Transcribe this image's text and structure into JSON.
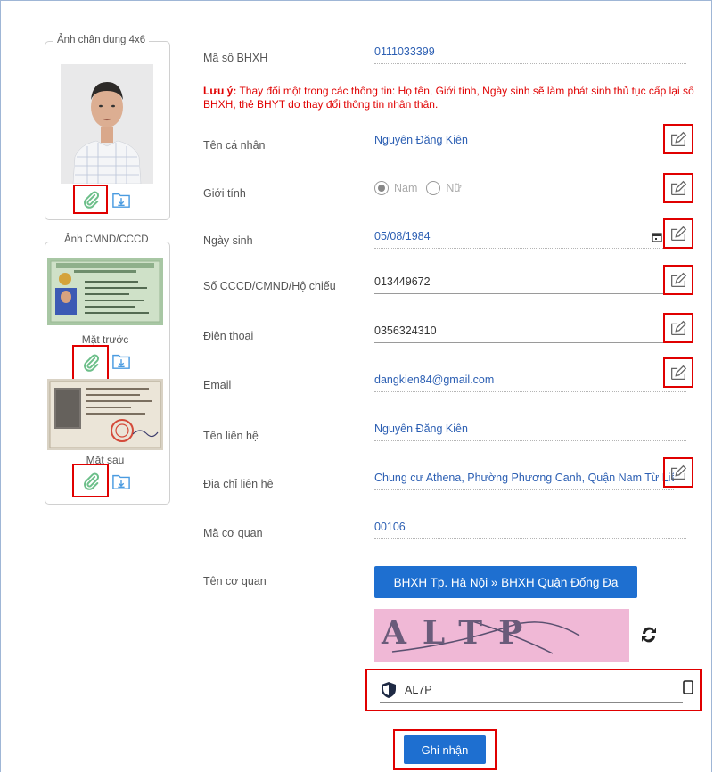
{
  "portrait": {
    "title": "Ảnh chân dung 4x6"
  },
  "id_card": {
    "title": "Ảnh CMND/CCCD",
    "front_caption": "Mặt trước",
    "back_caption": "Mặt sau"
  },
  "form": {
    "bhxh_code": {
      "label": "Mã số BHXH",
      "value": "0111033399"
    },
    "note": {
      "prefix": "Lưu ý:",
      "text": " Thay đổi một trong các thông tin: Họ tên, Giới tính, Ngày sinh sẽ làm phát sinh thủ tục cấp lại số BHXH, thẻ BHYT do thay đổi thông tin nhân thân."
    },
    "name": {
      "label": "Tên cá nhân",
      "value": "Nguyên Đăng Kiên"
    },
    "gender": {
      "label": "Giới tính",
      "option_male": "Nam",
      "option_female": "Nữ",
      "selected": "Nam"
    },
    "dob": {
      "label": "Ngày sinh",
      "value": "05/08/1984"
    },
    "id_number": {
      "label": "Số CCCD/CMND/Hộ chiếu",
      "value": "013449672"
    },
    "phone": {
      "label": "Điện thoại",
      "value": "0356324310"
    },
    "email": {
      "label": "Email",
      "value": "dangkien84@gmail.com"
    },
    "contact_name": {
      "label": "Tên liên hệ",
      "value": "Nguyên Đăng Kiên"
    },
    "contact_address": {
      "label": "Địa chỉ liên hệ",
      "value": "Chung cư Athena, Phường Phương Canh, Quận Nam Từ Liêm"
    },
    "org_code": {
      "label": "Mã cơ quan",
      "value": "00106"
    },
    "org_name": {
      "label": "Tên cơ quan",
      "value": "BHXH Tp. Hà Nội » BHXH Quận Đống Đa"
    }
  },
  "captcha": {
    "image_text": "ALTP",
    "input_value": "AL7P"
  },
  "submit": {
    "label": "Ghi nhận"
  },
  "colors": {
    "accent": "#1e6fd0",
    "highlight": "#e00000",
    "link_text": "#2c5fb3"
  }
}
